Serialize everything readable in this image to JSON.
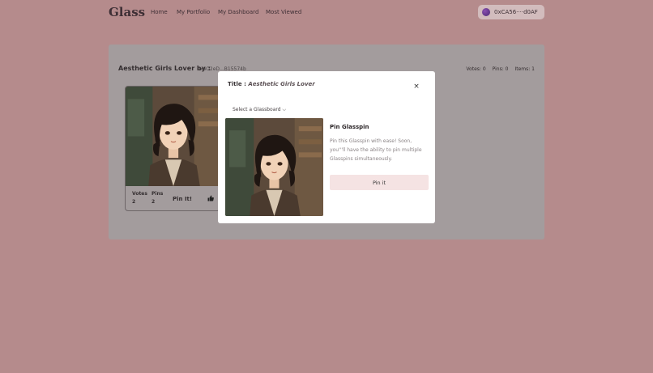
{
  "app": {
    "logo": "Glass",
    "nav": [
      "Home",
      "My Portfolio",
      "My Dashboard",
      "Most Viewed"
    ],
    "wallet": "0xCA56····d0AF"
  },
  "board": {
    "title": "Aesthetic Girls Lover by :",
    "owner": "0x6O2eD...B15574b",
    "votes": "Votes: 0",
    "pins": "Pins: 0",
    "items": "Items: 1"
  },
  "card": {
    "votes_label": "Votes",
    "votes_value": "2",
    "pins_label": "Pins",
    "pins_value": "2",
    "pin_it": "Pin It!",
    "like_icon": "thumbs-up-icon"
  },
  "modal": {
    "title_label": "Title : ",
    "title_value": "Aesthetic Girls Lover",
    "close": "×",
    "select_board": "Select a Glassboard ⌵",
    "heading": "Pin Glasspin",
    "description": "Pin this Glasspin with ease! Soon, you'''ll have the ability to pin multiple Glasspins simultaneously.",
    "button": "Pin it"
  },
  "colors": {
    "background": "#b58b8c",
    "board": "#a39c9d",
    "button": "#f5e3e3"
  }
}
